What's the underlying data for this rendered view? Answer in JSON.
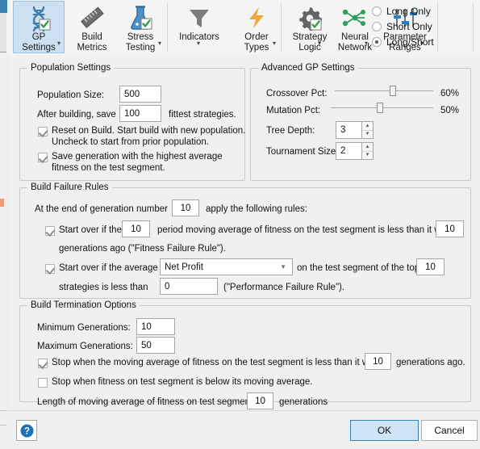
{
  "ribbon": {
    "buttons": [
      {
        "name": "gp-settings",
        "label": "GP\nSettings",
        "icon": "dna-icon",
        "caret": true,
        "selected": true,
        "badge": "check"
      },
      {
        "name": "build-metrics",
        "label": "Build\nMetrics",
        "icon": "ruler-icon",
        "caret": false,
        "selected": false,
        "badge": "none"
      },
      {
        "name": "stress-testing",
        "label": "Stress\nTesting",
        "icon": "flask-icon",
        "caret": true,
        "selected": false,
        "badge": "check"
      },
      {
        "name": "indicators",
        "label": "Indicators",
        "icon": "funnel-icon",
        "caret": true,
        "selected": false,
        "badge": "none"
      },
      {
        "name": "order-types",
        "label": "Order\nTypes",
        "icon": "lightning-icon",
        "caret": true,
        "selected": false,
        "badge": "none"
      },
      {
        "name": "strategy-logic",
        "label": "Strategy\nLogic",
        "icon": "gear-icon",
        "caret": true,
        "selected": false,
        "badge": "check"
      },
      {
        "name": "neural-network",
        "label": "Neural\nNetwork",
        "icon": "network-icon",
        "caret": true,
        "selected": false,
        "badge": "none"
      },
      {
        "name": "parameter-ranges",
        "label": "Parameter\nRanges",
        "icon": "sliders-icon",
        "caret": true,
        "selected": false,
        "badge": "none"
      }
    ],
    "direction_options": [
      {
        "label": "Long Only",
        "selected": false
      },
      {
        "label": "Short Only",
        "selected": false
      },
      {
        "label": "Long/Short",
        "selected": true
      }
    ]
  },
  "population_settings": {
    "title": "Population Settings",
    "population_size_label": "Population Size:",
    "population_size_value": "500",
    "after_building_label": "After building, save",
    "fittest_count_value": "100",
    "fittest_suffix": "fittest strategies.",
    "reset_on_build": {
      "checked": true,
      "line1": "Reset on Build. Start build with new population.",
      "line2": "Uncheck to start from prior population."
    },
    "save_generation": {
      "checked": true,
      "line1": "Save generation with the highest average",
      "line2": "fitness on the test segment."
    }
  },
  "advanced_gp_settings": {
    "title": "Advanced GP Settings",
    "crossover_label": "Crossover Pct:",
    "crossover_value": "60%",
    "crossover_pct": 60,
    "mutation_label": "Mutation Pct:",
    "mutation_value": "50%",
    "mutation_pct": 50,
    "tree_depth_label": "Tree Depth:",
    "tree_depth_value": "3",
    "tournament_size_label": "Tournament Size:",
    "tournament_size_value": "2"
  },
  "build_failure_rules": {
    "title": "Build Failure Rules",
    "gen_number_prefix": "At the end of generation number",
    "gen_number_value": "10",
    "gen_number_suffix": "apply the following rules:",
    "fitness_rule": {
      "checked": true,
      "prefix": "Start over if the",
      "period_value": "10",
      "middle": "period moving average of fitness on the test segment is less than it was",
      "generations_value": "10",
      "line2": "generations ago (\"Fitness Failure Rule\")."
    },
    "performance_rule": {
      "checked": true,
      "prefix": "Start over if the average",
      "metric_value": "Net Profit",
      "middle": "on the test segment of the top",
      "top_value": "10",
      "line2_prefix": "strategies  is less than",
      "threshold_value": "0",
      "line2_suffix": "(\"Performance Failure Rule\")."
    }
  },
  "build_termination_options": {
    "title": "Build Termination Options",
    "min_generations_label": "Minimum Generations:",
    "min_generations_value": "10",
    "max_generations_label": "Maximum Generations:",
    "max_generations_value": "50",
    "stop_moving_average": {
      "checked": true,
      "prefix": "Stop when the moving average of fitness on the test segment is less than it was",
      "value": "10",
      "suffix": "generations ago."
    },
    "stop_below_average": {
      "checked": false,
      "label": "Stop when fitness on test segment is below its moving average."
    },
    "length_label": "Length of moving average of fitness on test segment:",
    "length_value": "10",
    "length_suffix": "generations"
  },
  "footer": {
    "help_label": "?",
    "ok_label": "OK",
    "cancel_label": "Cancel"
  },
  "colors": {
    "accent": "#3c7fb1",
    "selected_tab_bg": "#cde0f2",
    "panel_bg": "#f0f0f0"
  }
}
